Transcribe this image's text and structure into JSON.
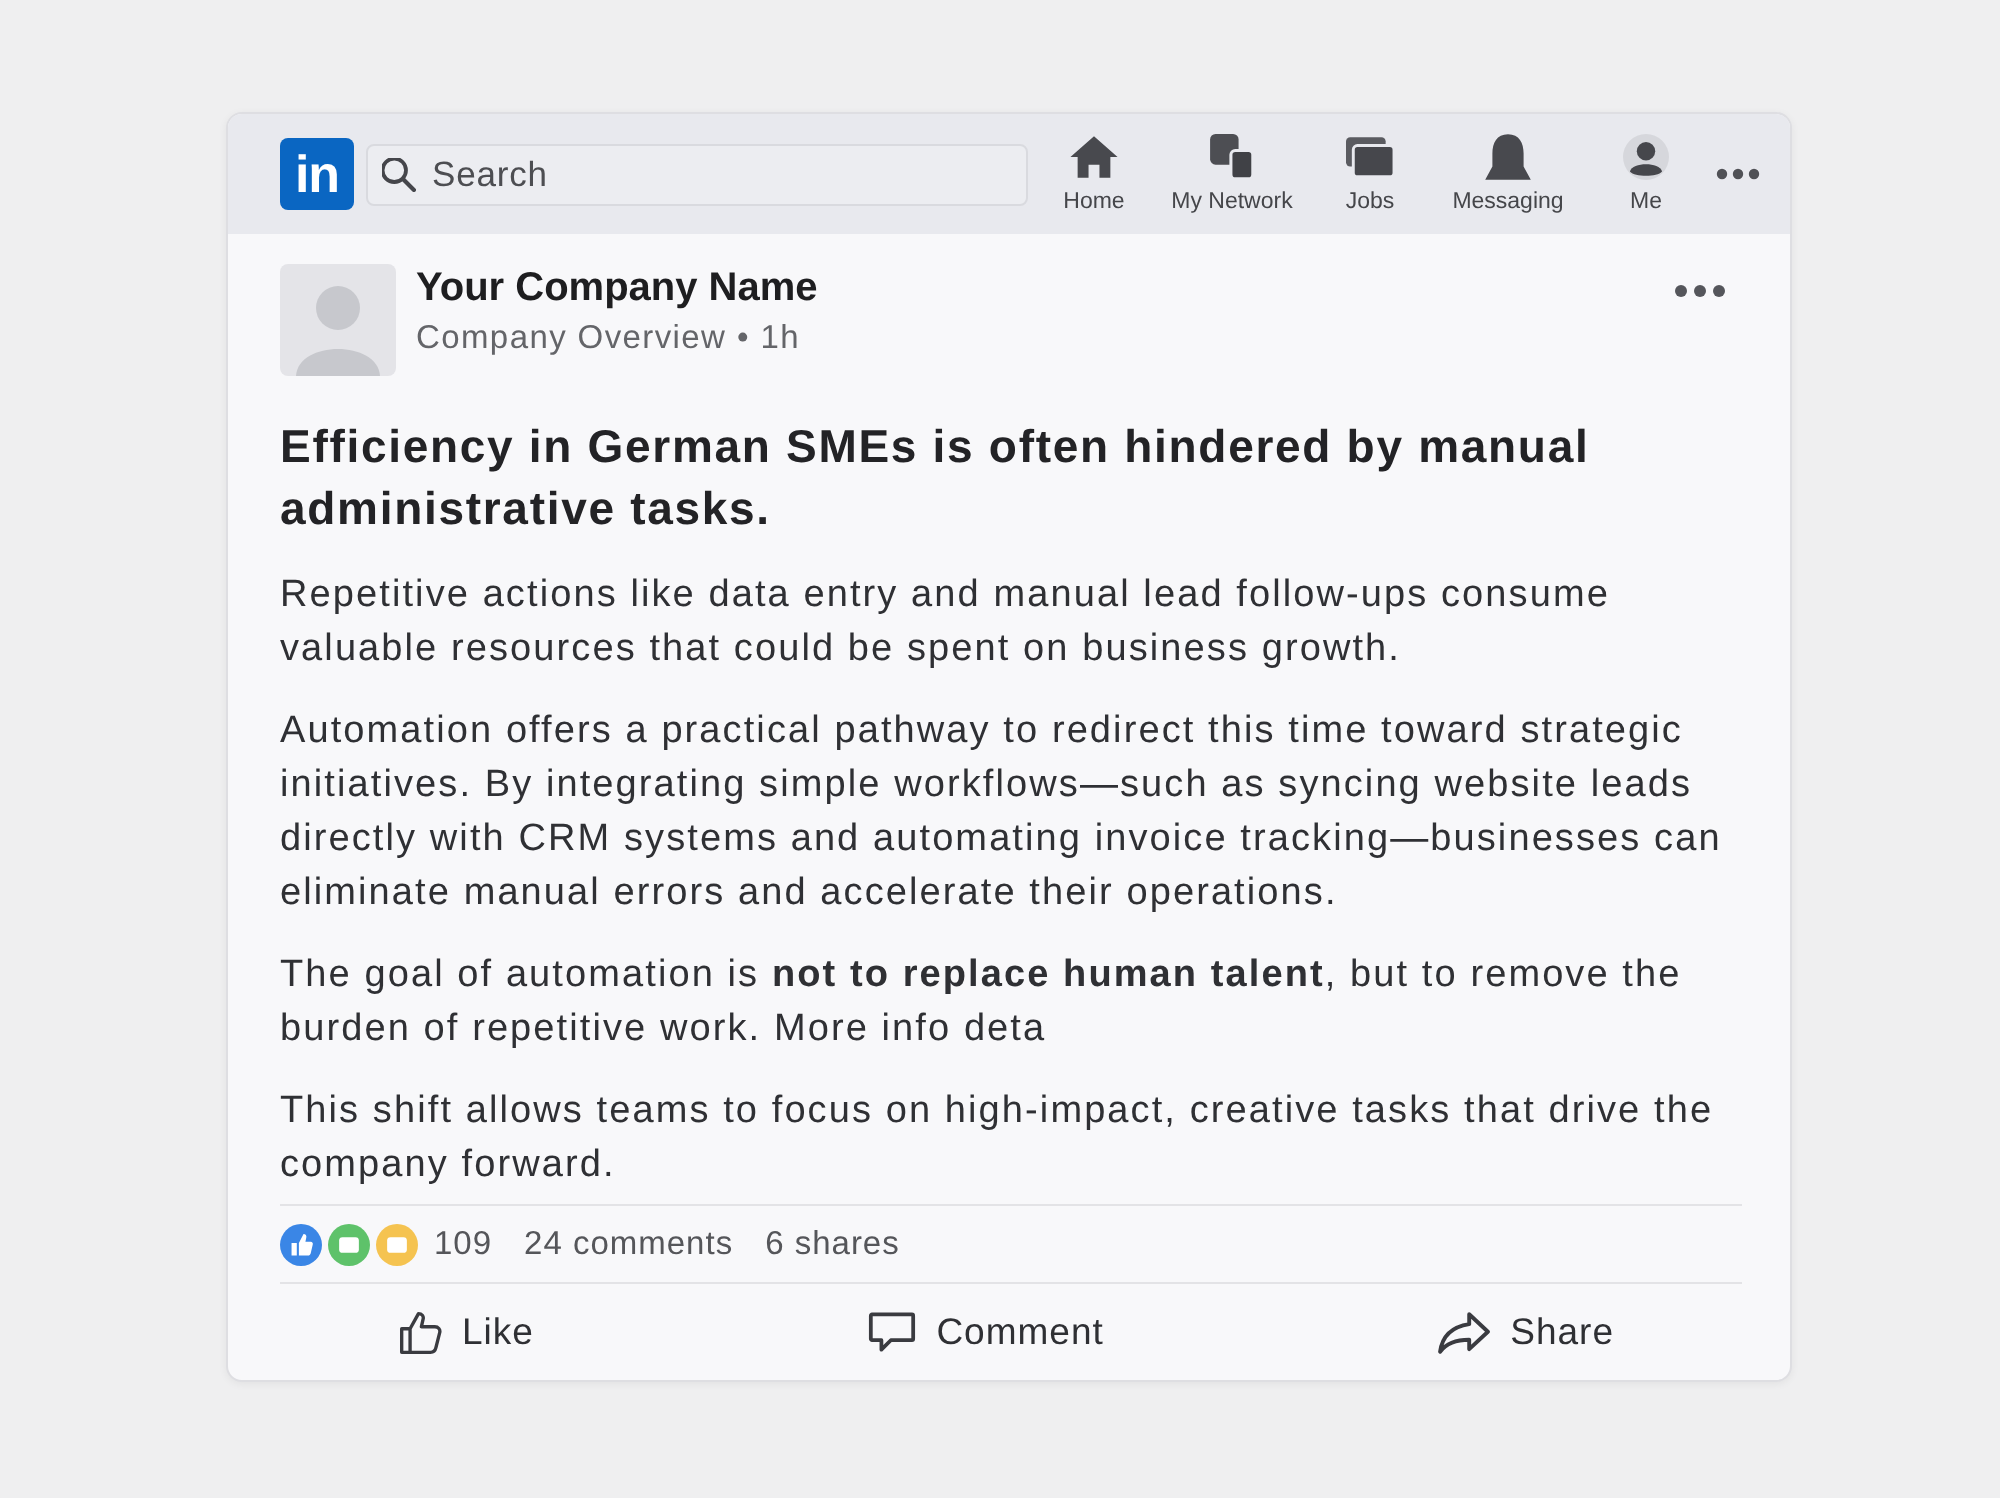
{
  "navbar": {
    "logo": "in",
    "search": {
      "placeholder": "Search"
    },
    "items": [
      {
        "kind": "home",
        "label": "Home"
      },
      {
        "kind": "network",
        "label": "My Network"
      },
      {
        "kind": "jobs",
        "label": "Jobs"
      },
      {
        "kind": "messaging",
        "label": "Messaging"
      },
      {
        "kind": "me",
        "label": "Me"
      }
    ]
  },
  "post": {
    "author": "Your Company Name",
    "meta": "Company Overview • 1h",
    "headline": "Efficiency in German SMEs is often hindered by manual administrative tasks.",
    "paragraphs": [
      "Repetitive actions like data entry and manual lead follow-ups consume valuable resources that could be spent on business growth.",
      "Automation offers a practical pathway to redirect this time toward strategic initiatives. By integrating simple workflows—such as syncing website leads directly with CRM systems and automating invoice tracking—businesses can eliminate manual errors and accelerate their operations.",
      "The goal of automation is **not to replace human talent**, but to remove the burden of repetitive work. More info deta",
      "This shift allows teams to focus on high-impact, creative tasks that drive the company forward."
    ],
    "reactions": [
      {
        "kind": "thumb",
        "color": "#3a86e6"
      },
      {
        "kind": "card",
        "color": "#5ec26a"
      },
      {
        "kind": "card",
        "color": "#f5c350"
      }
    ],
    "reaction_count": "109",
    "comments": "24 comments",
    "shares": "6 shares",
    "actions": [
      {
        "kind": "like",
        "label": "Like"
      },
      {
        "kind": "comment",
        "label": "Comment"
      },
      {
        "kind": "share",
        "label": "Share"
      }
    ]
  }
}
